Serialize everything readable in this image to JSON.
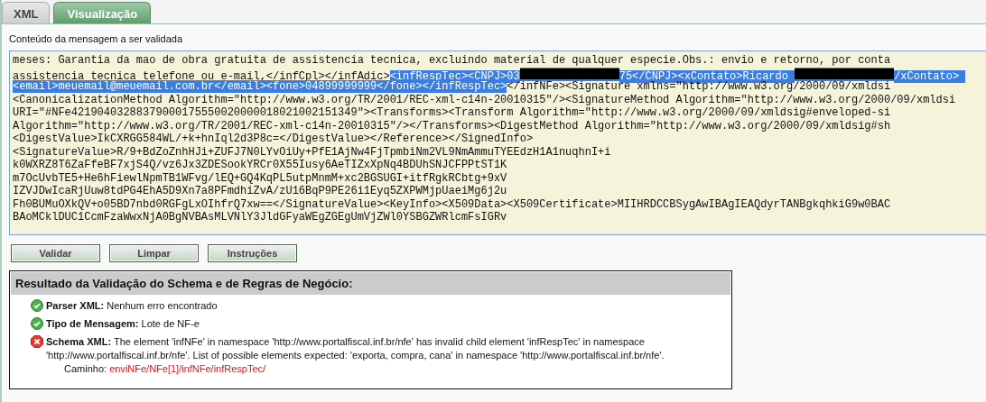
{
  "tabs": [
    {
      "label": "XML",
      "selected": false
    },
    {
      "label": "Visualização",
      "selected": true
    }
  ],
  "content_label": "Conteúdo da mensagem a ser validada",
  "xml_lines": [
    [
      {
        "kind": "text",
        "text": "meses: Garantia da mao de obra gratuita de assistencia tecnica, excluindo material de qualquer especie.Obs.: envio e retorno, por conta",
        "selected": false
      }
    ],
    [
      {
        "kind": "text",
        "text": "assistencia tecnica telefone ou e-mail,</infCpl></infAdic>",
        "selected": false
      },
      {
        "kind": "text",
        "text": "<infRespTec><CNPJ>03",
        "selected": true
      },
      {
        "kind": "redacted",
        "selected": true
      },
      {
        "kind": "text",
        "text": "75</CNPJ><xContato>Ricardo ",
        "selected": true
      },
      {
        "kind": "redacted",
        "selected": true
      },
      {
        "kind": "text",
        "text": "/xContato> ",
        "selected": true
      }
    ],
    [
      {
        "kind": "text",
        "text": "<email>meuemail@meuemail.com.br</email><fone>04899999999</fone></infRespTec>",
        "selected": true
      },
      {
        "kind": "text",
        "text": "</infNFe><Signature xmlns=\"http://www.w3.org/2000/09/xmldsi",
        "selected": false
      }
    ],
    [
      {
        "kind": "text",
        "text": "<CanonicalizationMethod Algorithm=\"http://www.w3.org/TR/2001/REC-xml-c14n-20010315\"/><SignatureMethod Algorithm=\"http://www.w3.org/2000/09/xmldsi",
        "selected": false
      }
    ],
    [
      {
        "kind": "text",
        "text": "URI=\"#NFe42190403288379000175550020000018021002151349\"><Transforms><Transform Algorithm=\"http://www.w3.org/2000/09/xmldsig#enveloped-si",
        "selected": false
      }
    ],
    [
      {
        "kind": "text",
        "text": "Algorithm=\"http://www.w3.org/TR/2001/REC-xml-c14n-20010315\"/></Transforms><DigestMethod Algorithm=\"http://www.w3.org/2000/09/xmldsig#sh",
        "selected": false
      }
    ],
    [
      {
        "kind": "text",
        "text": "<DigestValue>IkCXRGG584WL/+k+hnIql2d3P8c=</DigestValue></Reference></SignedInfo>",
        "selected": false
      }
    ],
    [
      {
        "kind": "text",
        "text": "<SignatureValue>R/9+BdZoZnhHJi+ZUFJ7N0LYvOiUy+PfE1AjNw4FjTpmbiNm2VL9NmAmmuTYEEdzH1A1nuqhnI+i",
        "selected": false
      }
    ],
    [
      {
        "kind": "text",
        "text": "k0WXRZ8T6ZaFfeBF7xjS4Q/vz6Jx3ZDESookYRCr0X55Iusy6AeTIZxXpNq4BDUhSNJCFPPtST1K",
        "selected": false
      }
    ],
    [
      {
        "kind": "text",
        "text": "m7OcUvbTE5+He6hFiewlNpmTB1WFvg/lEQ+GQ4KqPL5utpMnmM+xc2BGSUGI+itfRgkRCbtg+9xV",
        "selected": false
      }
    ],
    [
      {
        "kind": "text",
        "text": "IZVJDwIcaRjUuw8tdPG4EhA5D9Xn7a8PFmdhiZvA/zU16BqP9PE26i1Eyq5ZXPWMjpUaeiMg6j2u",
        "selected": false
      }
    ],
    [
      {
        "kind": "text",
        "text": "Fh0BUMuOXkQV+o05BD7nbd0RGFgLxOIhfrQ7xw==</SignatureValue><KeyInfo><X509Data><X509Certificate>MIIHRDCCBSygAwIBAgIEAQdyrTANBgkqhkiG9w0BAC",
        "selected": false
      }
    ],
    [
      {
        "kind": "text",
        "text": "BAoMCklDUC1CcmFzaWwxNjA0BgNVBAsMLVNlY3JldGFyaWEgZGEgUmVjZWl0YSBGZWRlcmFsIGRv",
        "selected": false
      }
    ]
  ],
  "buttons": [
    "Validar",
    "Limpar",
    "Instruções"
  ],
  "result": {
    "title": "Resultado da Validação do Schema e de Regras de Negócio:",
    "items": [
      {
        "kind": "ok",
        "label": "Parser XML:",
        "text": "Nenhum erro encontrado"
      },
      {
        "kind": "ok",
        "label": "Tipo de Mensagem:",
        "text": "Lote de NF-e"
      },
      {
        "kind": "error",
        "label": "Schema XML:",
        "text": "The element 'infNFe' in namespace 'http://www.portalfiscal.inf.br/nfe' has invalid child element 'infRespTec' in namespace 'http://www.portalfiscal.inf.br/nfe'. List of possible elements expected: 'exporta, compra, cana' in namespace 'http://www.portalfiscal.inf.br/nfe'.",
        "path_label": "Caminho:",
        "path": "enviNFe/NFe[1]/infNFe/infRespTec/"
      }
    ]
  }
}
